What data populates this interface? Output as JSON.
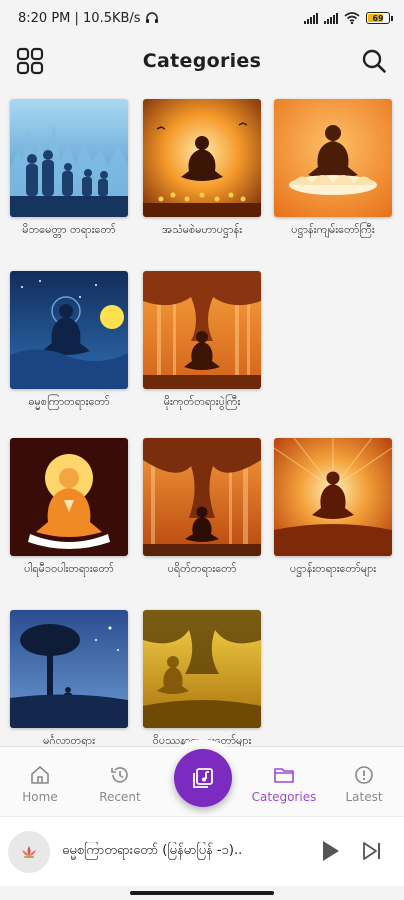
{
  "status_bar": {
    "time_speed": "8:20 PM | 10.5KB/s",
    "battery": "69"
  },
  "header": {
    "title": "Categories",
    "menu_icon": "grid-icon",
    "search_icon": "search-icon"
  },
  "categories": [
    {
      "label": "မိဘမေတ္တာ တရားတော်",
      "image": "people-walking-blue"
    },
    {
      "label": "အသံမစဲမဟာပဋ္ဌာန်း",
      "image": "buddha-candles"
    },
    {
      "label": "ပဋ္ဌာန်းကျမ်းတော်ကြီး",
      "image": "buddha-lotus-orange"
    },
    {
      "label": "ဓမ္မစကြာတရားတော်",
      "image": "buddha-night-moon"
    },
    {
      "label": "မိုးကုတ်တရားပွဲကြီး",
      "image": "buddha-bodhi-tree"
    },
    {
      "label": "ပါရမီ၁၀ပါးတရားတော်",
      "image": "buddha-hands-together"
    },
    {
      "label": "ပရိတ်တရားတော်",
      "image": "buddha-tree-sunset"
    },
    {
      "label": "ပဋ္ဌာန်းတရားတော်များ",
      "image": "buddha-radiant"
    },
    {
      "label": "မင်္ဂလာတရား",
      "image": "tree-night-blue"
    },
    {
      "label": "ဝိပဿနာတရားတော်များ",
      "image": "buddha-golden-forest"
    }
  ],
  "bottom_nav": {
    "items": [
      {
        "label": "Home",
        "icon": "home-icon"
      },
      {
        "label": "Recent",
        "icon": "history-icon"
      },
      {
        "label": "Categories",
        "icon": "folder-icon"
      },
      {
        "label": "Latest",
        "icon": "info-icon"
      }
    ],
    "active": "Categories",
    "fab_icon": "music-library-icon",
    "accent": "#7b2bbf"
  },
  "player": {
    "title": "ဓမ္မစကြာတရားတော် (မြန်မာပြန် -၁)..",
    "play_icon": "play-icon",
    "next_icon": "skip-next-icon"
  }
}
